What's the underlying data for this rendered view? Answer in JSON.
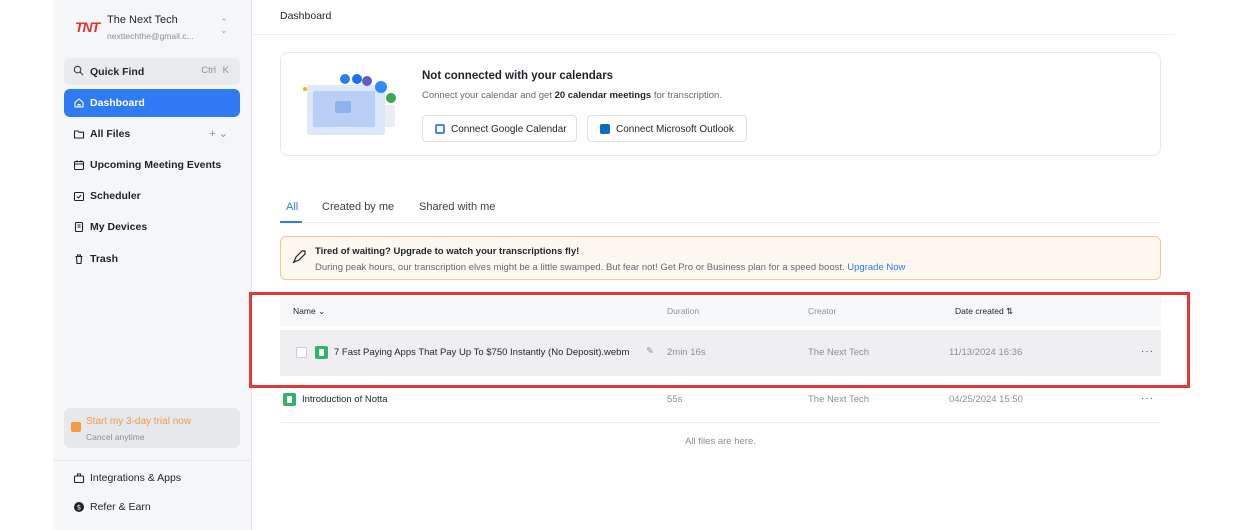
{
  "account": {
    "logo": "TNT",
    "name": "The Next Tech",
    "email": "nexttechthe@gmail.c..."
  },
  "sidebar": {
    "quick_find": {
      "label": "Quick Find",
      "keys": [
        "Ctrl",
        "K"
      ]
    },
    "items": [
      {
        "label": "Dashboard",
        "icon": "home-icon",
        "active": true
      },
      {
        "label": "All Files",
        "icon": "folder-icon",
        "extra": "+ ⌄"
      },
      {
        "label": "Upcoming Meeting Events",
        "icon": "calendar-icon"
      },
      {
        "label": "Scheduler",
        "icon": "scheduler-icon"
      },
      {
        "label": "My Devices",
        "icon": "device-icon"
      },
      {
        "label": "Trash",
        "icon": "trash-icon"
      }
    ],
    "trial": {
      "title": "Start my 3-day trial now",
      "subtitle": "Cancel anytime"
    },
    "bottom_items": [
      {
        "label": "Integrations & Apps",
        "icon": "integrations-icon"
      },
      {
        "label": "Refer & Earn",
        "icon": "dollar-icon"
      }
    ]
  },
  "header": {
    "breadcrumb": "Dashboard"
  },
  "calendar_card": {
    "title": "Not connected with your calendars",
    "desc_prefix": "Connect your calendar and get ",
    "desc_bold": "20 calendar meetings",
    "desc_suffix": " for transcription.",
    "google_button": "Connect Google Calendar",
    "outlook_button": "Connect Microsoft Outlook"
  },
  "tabs": [
    "All",
    "Created by me",
    "Shared with me"
  ],
  "banner": {
    "title": "Tired of waiting?  Upgrade to watch your transcriptions fly!",
    "text": "During peak hours, our transcription elves might be a little swamped. But fear not! Get Pro or Business plan for a speed boost.",
    "link": "Upgrade Now"
  },
  "table": {
    "headers": {
      "name": "Name",
      "duration": "Duration",
      "creator": "Creator",
      "date": "Date created"
    },
    "rows": [
      {
        "name": "7 Fast Paying Apps That Pay Up To $750 Instantly (No Deposit).webm",
        "duration": "2min 16s",
        "creator": "The Next Tech",
        "date": "11/13/2024 16:36",
        "more": "···"
      },
      {
        "name": "Introduction of Notta",
        "duration": "55s",
        "creator": "The Next Tech",
        "date": "04/25/2024 15:50",
        "more": "···"
      }
    ],
    "footer": "All files are here."
  },
  "colors": {
    "accent": "#2f7bf5",
    "highlight_box": "#e53935",
    "trial": "#f29a46",
    "file_icon": "#32b36b"
  }
}
